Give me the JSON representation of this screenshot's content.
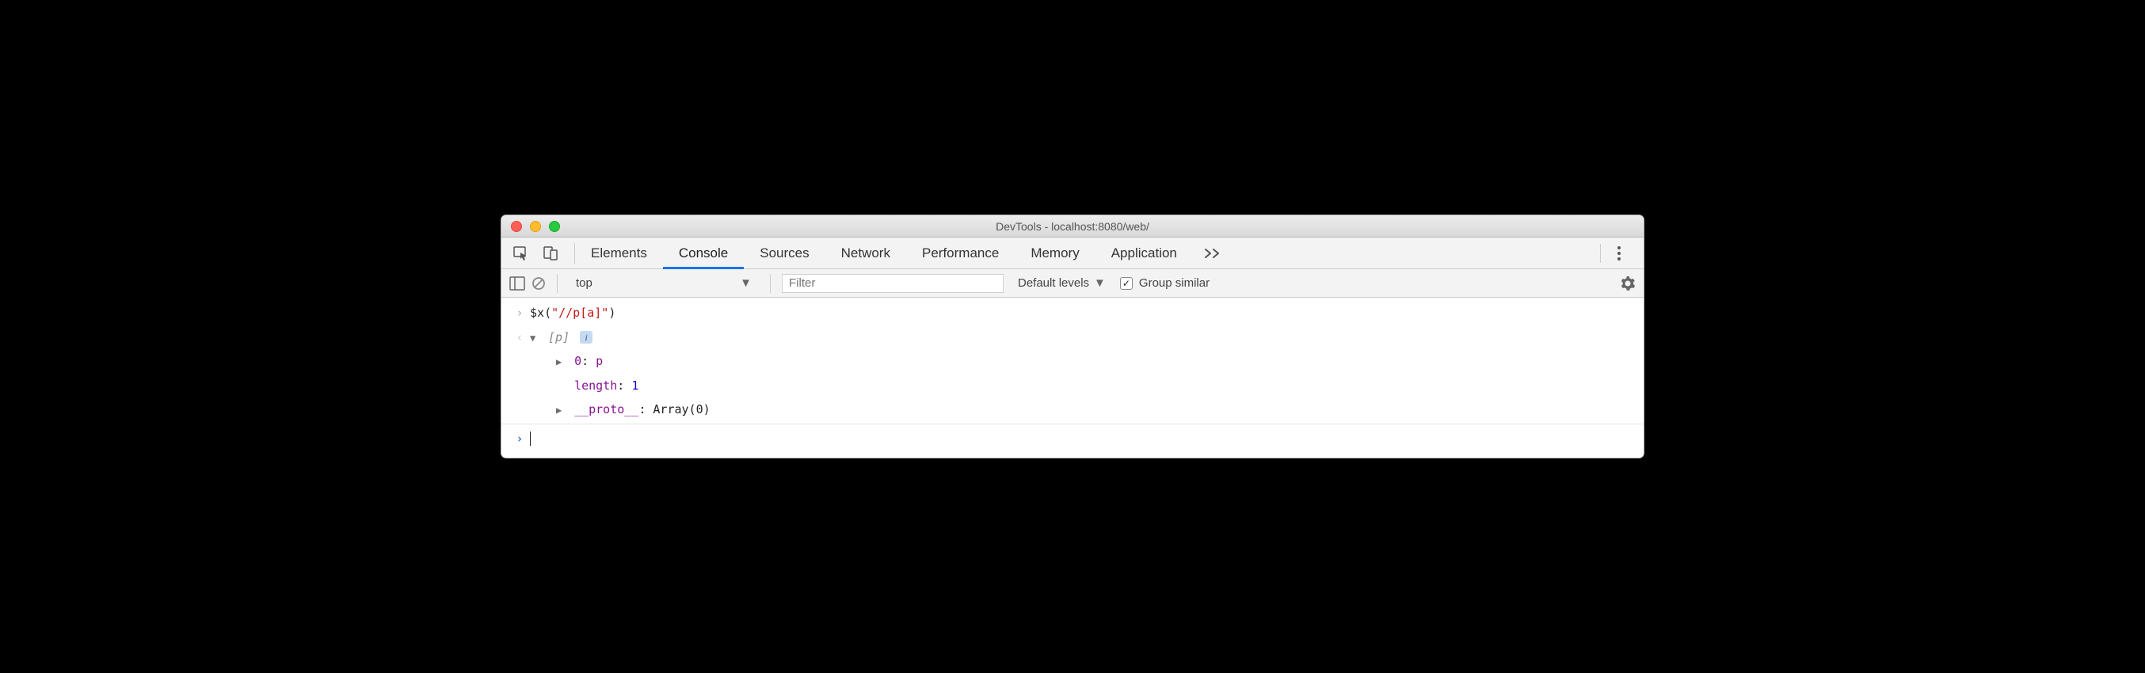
{
  "window": {
    "title": "DevTools - localhost:8080/web/"
  },
  "tabs": {
    "items": [
      "Elements",
      "Console",
      "Sources",
      "Network",
      "Performance",
      "Memory",
      "Application"
    ],
    "active": "Console"
  },
  "consoleToolbar": {
    "context": "top",
    "filter_placeholder": "Filter",
    "levels_label": "Default levels",
    "group_similar_label": "Group similar",
    "group_similar_checked": true
  },
  "console": {
    "input_fn": "$x",
    "input_arg": "\"//p[a]\"",
    "result_summary": "[p]",
    "result_entries": [
      {
        "arrow": "▶",
        "key": "0",
        "value": "p",
        "value_class": "tok-key"
      },
      {
        "arrow": "",
        "key": "length",
        "value": "1",
        "value_class": "tok-num"
      },
      {
        "arrow": "▶",
        "key": "__proto__",
        "value": "Array(0)",
        "value_class": "tok-plain"
      }
    ]
  }
}
